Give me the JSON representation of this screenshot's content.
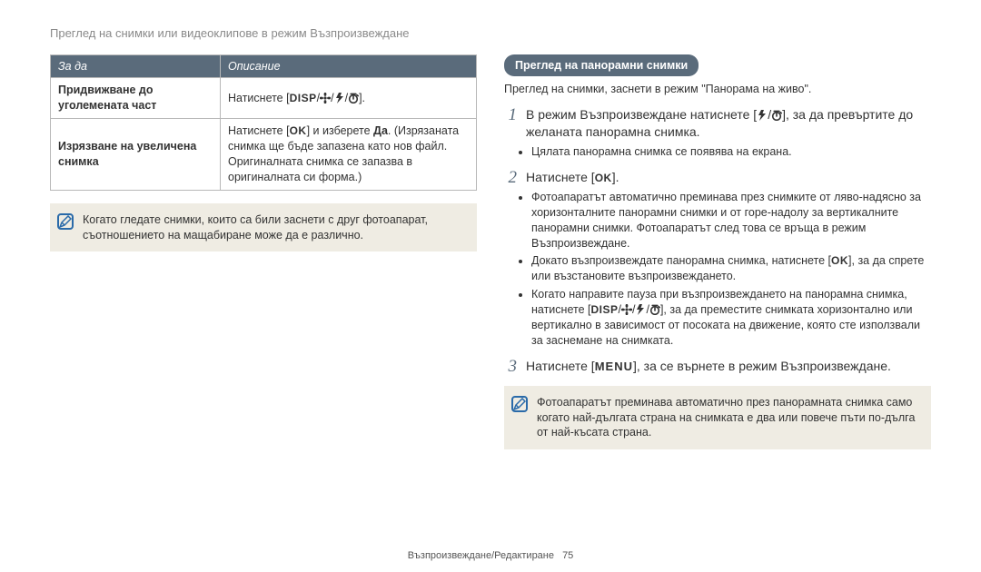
{
  "breadcrumb": "Преглед на снимки или видеоклипове в режим Възпроизвеждане",
  "table": {
    "headers": {
      "action": "За да",
      "desc": "Описание"
    },
    "rows": [
      {
        "label": "Придвижване до уголемената част",
        "desc_pre": "Натиснете [",
        "desc_post": "]."
      },
      {
        "label": "Изрязване на увеличена снимка",
        "desc_pre": "Натиснете [",
        "desc_mid1": "] и изберете ",
        "yes": "Да",
        "desc_mid2": ". (Изрязаната снимка ще бъде запазена като нов файл. Оригиналната снимка се запазва в оригиналната си форма.)"
      }
    ]
  },
  "icons": {
    "disp": "DISP",
    "ok": "OK",
    "menu": "MENU"
  },
  "left_note": "Когато гледате снимки, които са били заснети с друг фотоапарат, съотношението на мащабиране може да е различно.",
  "section_title": "Преглед на панорамни снимки",
  "section_intro": "Преглед на снимки, заснети в режим \"Панорама на живо\".",
  "steps": [
    {
      "num": "1",
      "pre": "В режим Възпроизвеждане натиснете [",
      "post": "], за да превъртите до желаната панорамна снимка.",
      "bullets": [
        {
          "text": "Цялата панорамна снимка се появява на екрана."
        }
      ]
    },
    {
      "num": "2",
      "pre": "Натиснете [",
      "post": "].",
      "bullets": [
        {
          "text": "Фотоапаратът автоматично преминава през снимките от ляво-надясно за хоризонталните панорамни снимки и от горе-надолу за вертикалните панорамни снимки. Фотоапаратът след това се връща в режим Възпроизвеждане."
        },
        {
          "pre": "Докато възпроизвеждате панорамна снимка, натиснете [",
          "post": "], за да спрете или възстановите възпроизвеждането."
        },
        {
          "pre": "Когато направите пауза при възпроизвеждането на панорамна снимка, натиснете [",
          "post": "], за да преместите снимката хоризонтално или вертикално в зависимост от посоката на движение, която сте използвали за заснемане на снимката."
        }
      ]
    },
    {
      "num": "3",
      "pre": "Натиснете [",
      "post": "], за се върнете в режим Възпроизвеждане."
    }
  ],
  "right_note": "Фотоапаратът преминава автоматично през панорамната снимка само когато най-дългата страна на снимката е два или повече пъти по-дълга от най-късата страна.",
  "footer": {
    "section": "Възпроизвеждане/Редактиране",
    "page": "75"
  }
}
